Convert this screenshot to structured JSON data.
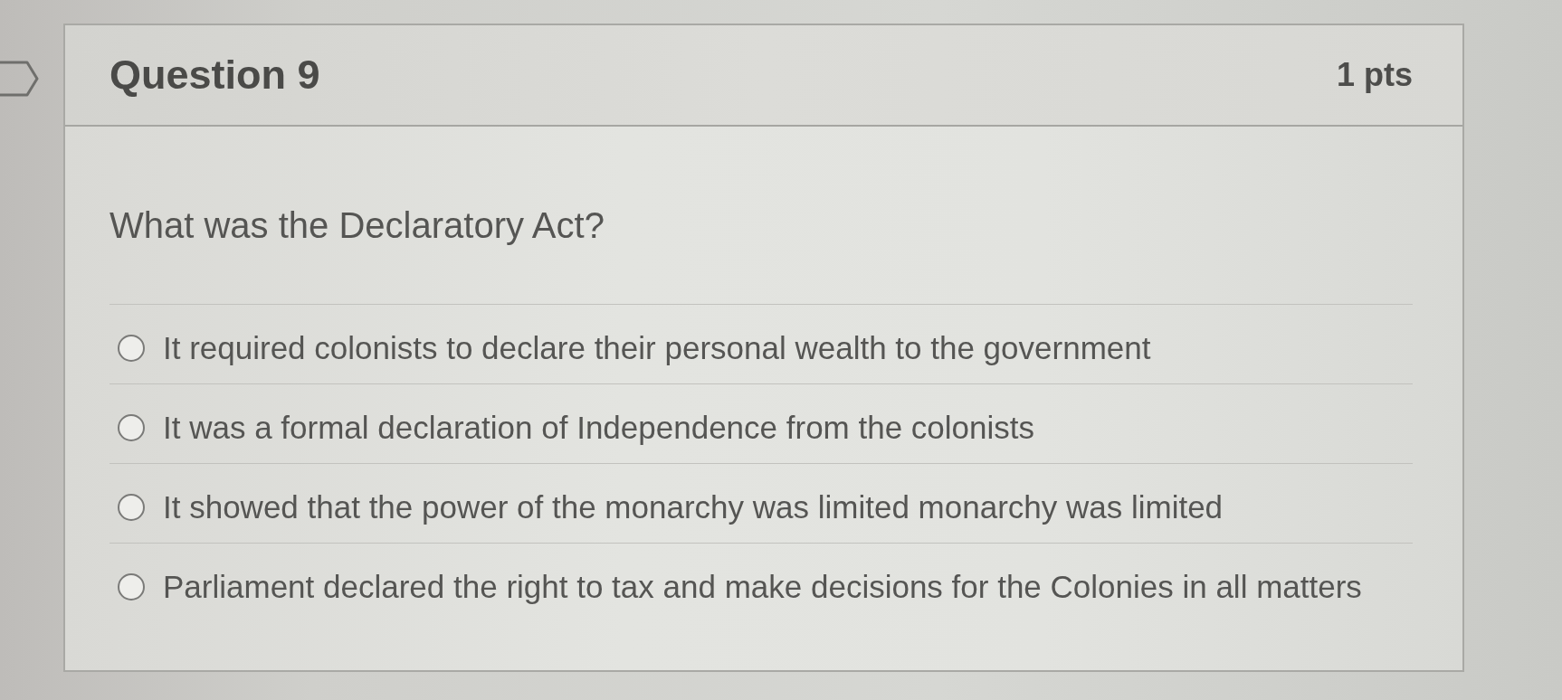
{
  "question": {
    "title": "Question 9",
    "points": "1 pts",
    "text": "What was the Declaratory Act?",
    "answers": [
      {
        "text": "It required colonists to declare their personal wealth to the government",
        "selected": false
      },
      {
        "text": "It was a formal declaration of Independence from the colonists",
        "selected": false
      },
      {
        "text": "It showed that the power of the monarchy was limited monarchy was limited",
        "selected": false
      },
      {
        "text": "Parliament declared the right to tax and make decisions for the Colonies in all matters",
        "selected": false
      }
    ]
  }
}
